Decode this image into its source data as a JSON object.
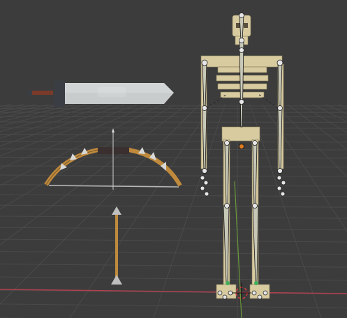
{
  "viewport": {
    "background_color": "#3c3c3c",
    "grid_color": "#4a4a4a",
    "x_axis_color": "#b0414f",
    "y_axis_color": "#6a9a3a"
  },
  "objects": {
    "sword": {
      "blade_color": "#c9cccd",
      "guard_color": "#3a3e44",
      "grip_color": "#7a3a2a"
    },
    "bow": {
      "limb_color": "#c08a3c",
      "string_color": "#b8b8b8",
      "spike_color": "#d8d8d8"
    },
    "arrow": {
      "shaft_color": "#c08a3c",
      "head_color": "#bfbfbf"
    },
    "skeleton": {
      "bone_color": "#d8cba0",
      "armature_color": "#e6e6e6",
      "selected_joint_color": "#e07a1f"
    }
  },
  "overlays": {
    "cursor_3d_icon": "3d-cursor-icon",
    "origin_icon": "origin-icon"
  }
}
